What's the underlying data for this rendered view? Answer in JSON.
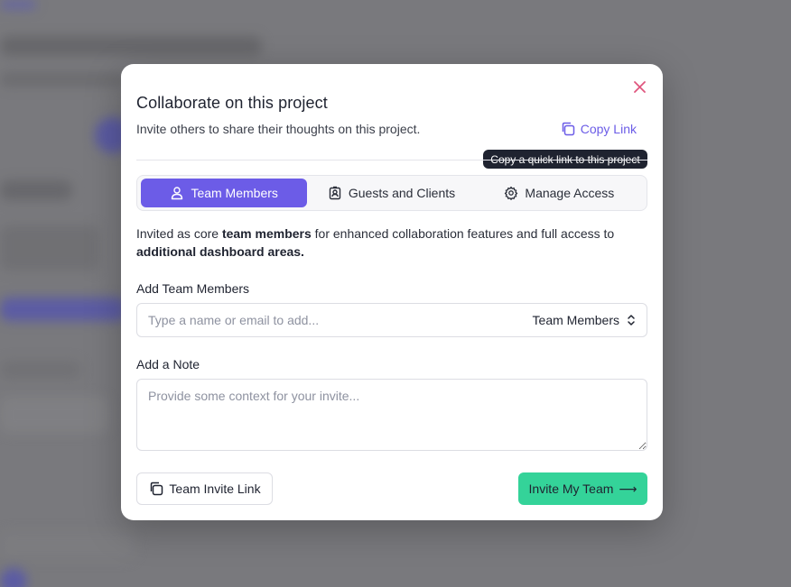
{
  "modal": {
    "title": "Collaborate on this project",
    "subtitle": "Invite others to share their thoughts on this project.",
    "copy_link_label": "Copy Link",
    "copy_link_tooltip": "Copy a quick link to this project",
    "close_icon": "close-icon"
  },
  "tabs": [
    {
      "label": "Team Members",
      "icon": "user-icon",
      "active": true
    },
    {
      "label": "Guests and Clients",
      "icon": "id-badge-icon",
      "active": false
    },
    {
      "label": "Manage Access",
      "icon": "gear-icon",
      "active": false
    }
  ],
  "description": {
    "part1": "Invited as core ",
    "bold1": "team members",
    "part2": " for enhanced collaboration features and full access to ",
    "bold2": "additional dashboard areas."
  },
  "add_members": {
    "label": "Add Team Members",
    "placeholder": "Type a name or email to add...",
    "value": "",
    "role_selected": "Team Members"
  },
  "note": {
    "label": "Add a Note",
    "placeholder": "Provide some context for your invite...",
    "value": ""
  },
  "footer": {
    "invite_link_label": "Team Invite Link",
    "invite_button_label": "Invite My Team",
    "invite_arrow": "⟶"
  },
  "colors": {
    "accent": "#6c5ce7",
    "close": "#e0577f",
    "invite_button": "#34d399",
    "tooltip_bg": "#1f2330"
  }
}
